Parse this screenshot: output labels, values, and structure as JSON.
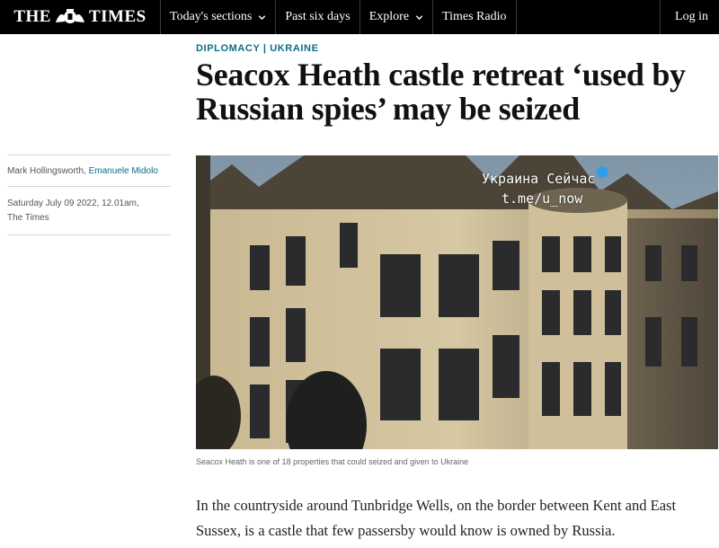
{
  "nav": {
    "logo_left": "THE",
    "logo_right": "TIMES",
    "items": [
      {
        "label": "Today's sections",
        "has_dropdown": true
      },
      {
        "label": "Past six days",
        "has_dropdown": false
      },
      {
        "label": "Explore",
        "has_dropdown": true
      },
      {
        "label": "Times Radio",
        "has_dropdown": false
      }
    ],
    "login_label": "Log in"
  },
  "article": {
    "kicker_section": "DIPLOMACY",
    "kicker_separator": "|",
    "kicker_topic": "UKRAINE",
    "headline": "Seacox Heath castle retreat ‘used by Russian spies’ may be seized",
    "byline": {
      "author_1": "Mark Hollingsworth,",
      "author_2": "Emanuele Midolo",
      "date": "Saturday July 09 2022, 12.01am,",
      "publication": "The Times"
    },
    "image": {
      "watermark_line1": "Украина Сейчас",
      "watermark_line2": "t.me/u_now",
      "caption": "Seacox Heath is one of 18 properties that could seized and given to Ukraine"
    },
    "body_paragraph": "In the countryside around Tunbridge Wells, on the border between Kent and East Sussex, is a castle that few passersby would know is owned by Russia."
  },
  "colors": {
    "nav_background": "#000000",
    "accent_link": "#0a6f8a",
    "telegram_badge": "#2f9ee8"
  }
}
